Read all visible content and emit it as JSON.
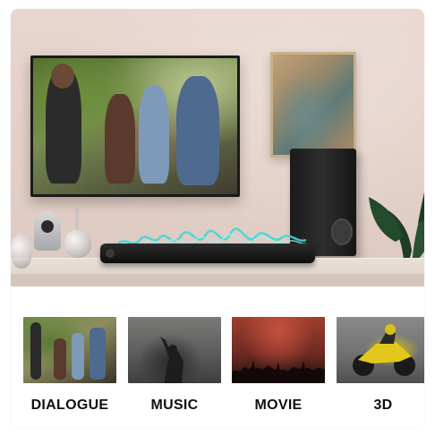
{
  "modes": [
    {
      "label": "DIALOGUE",
      "thumb": "dialogue-scene-image"
    },
    {
      "label": "MUSIC",
      "thumb": "music-performer-image"
    },
    {
      "label": "MOVIE",
      "thumb": "movie-crowd-image"
    },
    {
      "label": "3D",
      "thumb": "motorcycle-race-image"
    }
  ],
  "colors": {
    "label_text": "#111111",
    "wave_cyan": "#3fd8d8",
    "wall": "#e4d2ca"
  }
}
